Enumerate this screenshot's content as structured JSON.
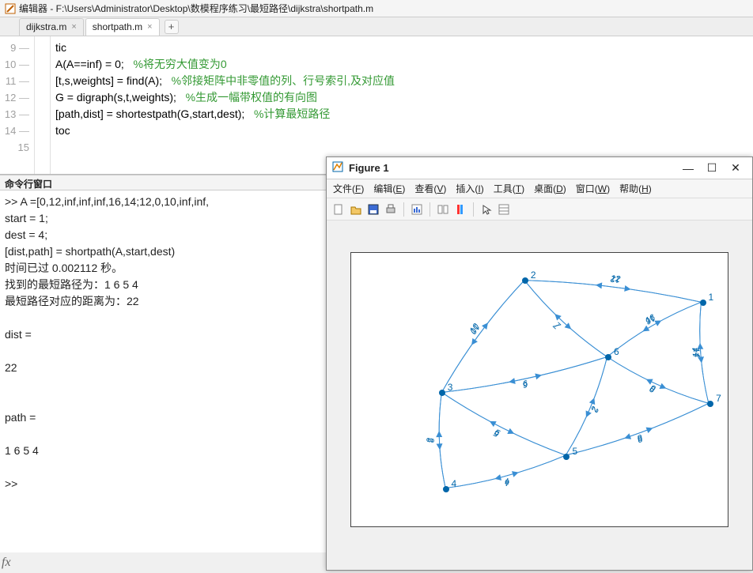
{
  "title_bar": {
    "label": "编辑器 - F:\\Users\\Administrator\\Desktop\\数模程序练习\\最短路径\\dijkstra\\shortpath.m"
  },
  "tabs": [
    {
      "label": "dijkstra.m",
      "active": false
    },
    {
      "label": "shortpath.m",
      "active": true
    }
  ],
  "editor_lines": [
    {
      "num": "9",
      "dash": "—",
      "code": "tic",
      "comment": ""
    },
    {
      "num": "10",
      "dash": "—",
      "code": "A(A==inf) = 0;   ",
      "comment": "%将无穷大值变为0"
    },
    {
      "num": "11",
      "dash": "—",
      "code": "[t,s,weights] = find(A);   ",
      "comment": "%邻接矩阵中非零值的列、行号索引,及对应值"
    },
    {
      "num": "12",
      "dash": "—",
      "code": "G = digraph(s,t,weights);   ",
      "comment": "%生成一幅带权值的有向图"
    },
    {
      "num": "13",
      "dash": "—",
      "code": "[path,dist] = shortestpath(G,start,dest);   ",
      "comment": "%计算最短路径"
    },
    {
      "num": "14",
      "dash": "—",
      "code": "toc",
      "comment": ""
    },
    {
      "num": "15",
      "dash": "",
      "code": "",
      "comment": ""
    }
  ],
  "cmd_header": {
    "label": "命令行窗口"
  },
  "cmd_lines": [
    ">>  A =[0,12,inf,inf,inf,16,14;12,0,10,inf,inf,",
    "start = 1;",
    "dest = 4;",
    "[dist,path] = shortpath(A,start,dest)",
    "时间已过 0.002112 秒。",
    "找到的最短路径为：1  6  5  4",
    "最短路径对应的距离为：22",
    "",
    "dist =",
    "",
    "    22",
    "",
    "",
    "path =",
    "",
    "     1     6     5     4",
    "",
    ">>"
  ],
  "fx": {
    "label": "fx"
  },
  "figure": {
    "title": "Figure 1",
    "menus": [
      {
        "plain": "文件(",
        "u": "F",
        "tail": ")"
      },
      {
        "plain": "编辑(",
        "u": "E",
        "tail": ")"
      },
      {
        "plain": "查看(",
        "u": "V",
        "tail": ")"
      },
      {
        "plain": "插入(",
        "u": "I",
        "tail": ")"
      },
      {
        "plain": "工具(",
        "u": "T",
        "tail": ")"
      },
      {
        "plain": "桌面(",
        "u": "D",
        "tail": ")"
      },
      {
        "plain": "窗口(",
        "u": "W",
        "tail": ")"
      },
      {
        "plain": "帮助(",
        "u": "H",
        "tail": ")"
      }
    ],
    "win_buttons": {
      "min": "—",
      "max": "☐",
      "close": "✕"
    }
  },
  "chart_data": {
    "type": "graph",
    "directed": true,
    "title": "",
    "nodes": [
      {
        "id": 1,
        "x": 0.93,
        "y": 0.18
      },
      {
        "id": 2,
        "x": 0.46,
        "y": 0.1
      },
      {
        "id": 3,
        "x": 0.24,
        "y": 0.51
      },
      {
        "id": 4,
        "x": 0.25,
        "y": 0.86
      },
      {
        "id": 5,
        "x": 0.57,
        "y": 0.74
      },
      {
        "id": 6,
        "x": 0.68,
        "y": 0.38
      },
      {
        "id": 7,
        "x": 0.95,
        "y": 0.55
      }
    ],
    "edges": [
      {
        "from": 1,
        "to": 2,
        "w": 12
      },
      {
        "from": 2,
        "to": 1,
        "w": 12
      },
      {
        "from": 1,
        "to": 6,
        "w": 16
      },
      {
        "from": 6,
        "to": 1,
        "w": 16
      },
      {
        "from": 1,
        "to": 7,
        "w": 14
      },
      {
        "from": 7,
        "to": 1,
        "w": 14
      },
      {
        "from": 2,
        "to": 3,
        "w": 10
      },
      {
        "from": 3,
        "to": 2,
        "w": 10
      },
      {
        "from": 2,
        "to": 6,
        "w": 7
      },
      {
        "from": 6,
        "to": 2,
        "w": 7
      },
      {
        "from": 3,
        "to": 4,
        "w": 3
      },
      {
        "from": 4,
        "to": 3,
        "w": 3
      },
      {
        "from": 3,
        "to": 5,
        "w": 5
      },
      {
        "from": 5,
        "to": 3,
        "w": 5
      },
      {
        "from": 3,
        "to": 6,
        "w": 6
      },
      {
        "from": 6,
        "to": 3,
        "w": 6
      },
      {
        "from": 4,
        "to": 5,
        "w": 4
      },
      {
        "from": 5,
        "to": 4,
        "w": 4
      },
      {
        "from": 5,
        "to": 6,
        "w": 2
      },
      {
        "from": 6,
        "to": 5,
        "w": 2
      },
      {
        "from": 5,
        "to": 7,
        "w": 8
      },
      {
        "from": 7,
        "to": 5,
        "w": 8
      },
      {
        "from": 6,
        "to": 7,
        "w": 9
      },
      {
        "from": 7,
        "to": 6,
        "w": 9
      }
    ]
  }
}
